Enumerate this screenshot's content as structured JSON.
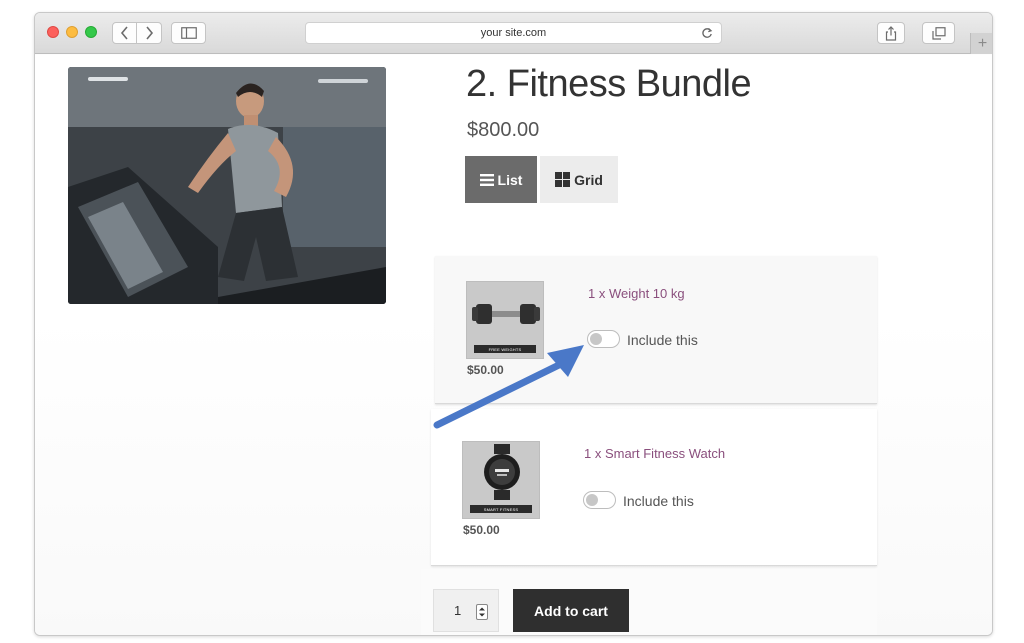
{
  "browser": {
    "url": "your site.com"
  },
  "product": {
    "title": "2. Fitness Bundle",
    "price": "$800.00",
    "image_desc_icon": "treadmill-runner-photo"
  },
  "view_toggle": {
    "list_label": "List",
    "grid_label": "Grid",
    "selected": "List"
  },
  "items": [
    {
      "name": "1 x Weight 10 kg",
      "price": "$50.00",
      "thumb_tag": "FREE WEIGHTS",
      "include_label": "Include this",
      "included": false
    },
    {
      "name": "1 x Smart Fitness Watch",
      "price": "$50.00",
      "thumb_tag": "SMART FITNESS",
      "include_label": "Include this",
      "included": false
    }
  ],
  "cart": {
    "quantity": "1",
    "add_label": "Add to cart"
  },
  "colors": {
    "accent_link": "#8a4f7d",
    "arrow": "#4a78c8",
    "list_active": "#6b6b6b",
    "cart_button": "#2f2f2f"
  }
}
